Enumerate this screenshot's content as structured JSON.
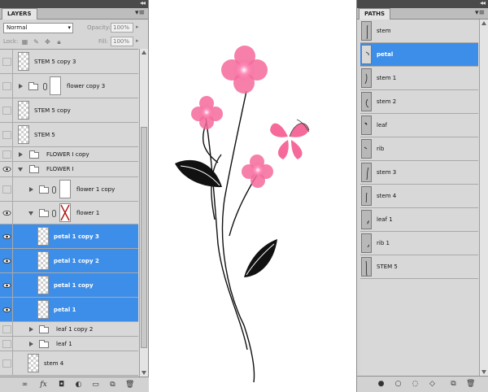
{
  "layers_panel": {
    "tab_label": "LAYERS",
    "collapse_glyph": "◂◂",
    "menu_glyph": "▾≡",
    "blend_mode": "Normal",
    "opacity_label": "Opacity:",
    "opacity_value": "100%",
    "lock_label": "Lock:",
    "fill_label": "Fill:",
    "fill_value": "100%",
    "layers": [
      {
        "name": "STEM 5 copy 3",
        "kind": "layer",
        "visible": false,
        "selected": false
      },
      {
        "name": "flower copy 3",
        "kind": "group-masked",
        "visible": false,
        "selected": false
      },
      {
        "name": "STEM 5 copy",
        "kind": "layer",
        "visible": false,
        "selected": false
      },
      {
        "name": "STEM 5",
        "kind": "layer",
        "visible": false,
        "selected": false
      },
      {
        "name": "FLOWER I copy",
        "kind": "group",
        "visible": false,
        "selected": false
      },
      {
        "name": "FLOWER I",
        "kind": "group-open",
        "visible": true,
        "selected": false
      },
      {
        "name": "flower 1 copy",
        "kind": "group-masked",
        "visible": false,
        "selected": false
      },
      {
        "name": "flower 1",
        "kind": "group-open-masked",
        "visible": true,
        "selected": false
      },
      {
        "name": "petal 1 copy 3",
        "kind": "layer",
        "visible": true,
        "selected": true
      },
      {
        "name": "petal 1 copy 2",
        "kind": "layer",
        "visible": true,
        "selected": true
      },
      {
        "name": "petal 1 copy",
        "kind": "layer",
        "visible": true,
        "selected": true
      },
      {
        "name": "petal 1",
        "kind": "layer",
        "visible": true,
        "selected": true
      },
      {
        "name": "leaf 1 copy 2",
        "kind": "group",
        "visible": false,
        "selected": false
      },
      {
        "name": "leaf 1",
        "kind": "group",
        "visible": false,
        "selected": false
      },
      {
        "name": "stem 4",
        "kind": "layer",
        "visible": false,
        "selected": false
      }
    ],
    "bottom_icons": [
      "link-icon",
      "fx-icon",
      "mask-icon",
      "adjustment-icon",
      "group-icon",
      "new-layer-icon",
      "trash-icon"
    ]
  },
  "paths_panel": {
    "tab_label": "PATHS",
    "collapse_glyph": "◂◂",
    "menu_glyph": "▾≡",
    "paths": [
      {
        "name": "stem",
        "selected": false
      },
      {
        "name": "petal",
        "selected": true
      },
      {
        "name": "stem 1",
        "selected": false
      },
      {
        "name": "stem 2",
        "selected": false
      },
      {
        "name": "leaf",
        "selected": false
      },
      {
        "name": "rib",
        "selected": false
      },
      {
        "name": "stem 3",
        "selected": false
      },
      {
        "name": "stem 4",
        "selected": false
      },
      {
        "name": "leaf 1",
        "selected": false
      },
      {
        "name": "rib 1",
        "selected": false
      },
      {
        "name": "STEM 5",
        "selected": false
      }
    ],
    "bottom_icons": [
      "fill-path-icon",
      "stroke-path-icon",
      "load-selection-icon",
      "make-work-path-icon",
      "new-path-icon",
      "delete-path-icon"
    ]
  },
  "colors": {
    "selection": "#3d8ee8",
    "petal_pink": "#f56a9b",
    "petal_light": "#ff9cc0",
    "panel_bg": "#d6d6d6"
  }
}
